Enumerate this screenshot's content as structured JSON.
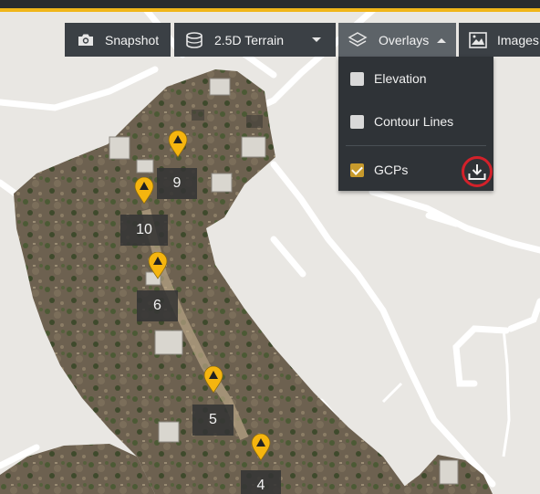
{
  "toolbar": {
    "snapshot_label": "Snapshot",
    "terrain_label": "2.5D Terrain",
    "overlays_label": "Overlays",
    "images_label": "Images"
  },
  "overlays_menu": {
    "items": [
      {
        "label": "Elevation",
        "checked": false
      },
      {
        "label": "Contour Lines",
        "checked": false
      },
      {
        "label": "GCPs",
        "checked": true
      }
    ]
  },
  "gcp_labels": [
    "9",
    "10",
    "6",
    "5",
    "4"
  ],
  "colors": {
    "accent": "#f0b619",
    "toolbar_bg": "#3b4045",
    "menu_bg": "#2f3337",
    "marker": "#f5b50f",
    "highlight_ring": "#d3212a"
  }
}
